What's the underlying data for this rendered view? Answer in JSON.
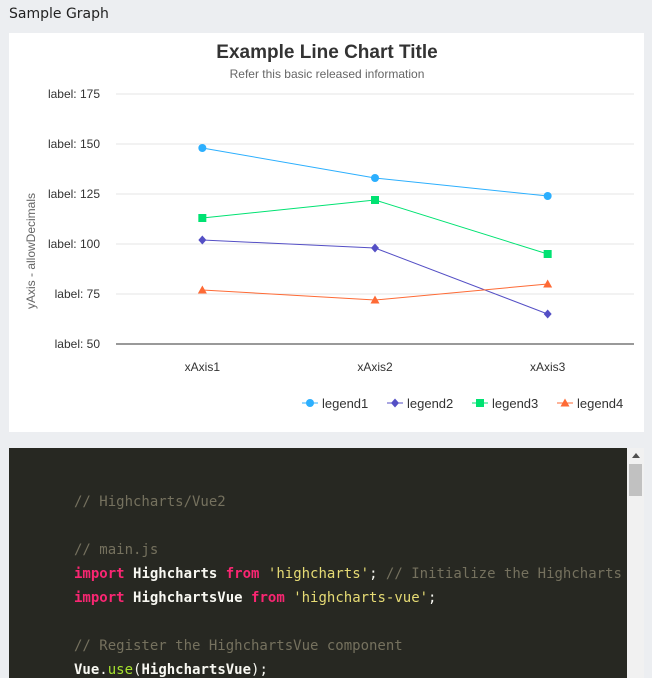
{
  "section_title": "Sample Graph",
  "chart_data": {
    "type": "line",
    "title": "Example Line Chart Title",
    "subtitle": "Refer this basic released information",
    "ylabel": "yAxis - allowDecimals",
    "xlabel": "",
    "categories": [
      "xAxis1",
      "xAxis2",
      "xAxis3"
    ],
    "ylim": [
      50,
      175
    ],
    "yticks": [
      50,
      75,
      100,
      125,
      150,
      175
    ],
    "ytick_prefix": "label: ",
    "grid": true,
    "legend_position": "bottom-right",
    "series": [
      {
        "name": "legend1",
        "values": [
          148,
          133,
          124
        ],
        "color": "#2caffe",
        "marker": "circle"
      },
      {
        "name": "legend2",
        "values": [
          102,
          98,
          65
        ],
        "color": "#544fc5",
        "marker": "diamond"
      },
      {
        "name": "legend3",
        "values": [
          113,
          122,
          95
        ],
        "color": "#00e272",
        "marker": "square"
      },
      {
        "name": "legend4",
        "values": [
          77,
          72,
          80
        ],
        "color": "#fe6a35",
        "marker": "triangle"
      }
    ]
  },
  "code_panel": {
    "lines": [
      [
        {
          "t": "// Highcharts/Vue2",
          "c": "comment"
        }
      ],
      [],
      [
        {
          "t": "// main.js",
          "c": "comment"
        }
      ],
      [
        {
          "t": "import",
          "c": "keyword"
        },
        {
          "t": " ",
          "c": "punct"
        },
        {
          "t": "Highcharts",
          "c": "ident"
        },
        {
          "t": " ",
          "c": "punct"
        },
        {
          "t": "from",
          "c": "keyword"
        },
        {
          "t": " ",
          "c": "punct"
        },
        {
          "t": "'highcharts'",
          "c": "string"
        },
        {
          "t": "; ",
          "c": "punct"
        },
        {
          "t": "// Initialize the Highcharts m",
          "c": "comment"
        }
      ],
      [
        {
          "t": "import",
          "c": "keyword"
        },
        {
          "t": " ",
          "c": "punct"
        },
        {
          "t": "HighchartsVue",
          "c": "ident"
        },
        {
          "t": " ",
          "c": "punct"
        },
        {
          "t": "from",
          "c": "keyword"
        },
        {
          "t": " ",
          "c": "punct"
        },
        {
          "t": "'highcharts-vue'",
          "c": "string"
        },
        {
          "t": ";",
          "c": "punct"
        }
      ],
      [],
      [
        {
          "t": "// Register the HighchartsVue component",
          "c": "comment"
        }
      ],
      [
        {
          "t": "Vue",
          "c": "ident"
        },
        {
          "t": ".",
          "c": "punct"
        },
        {
          "t": "use",
          "c": "func"
        },
        {
          "t": "(",
          "c": "punct"
        },
        {
          "t": "HighchartsVue",
          "c": "ident"
        },
        {
          "t": ");",
          "c": "punct"
        }
      ]
    ]
  }
}
